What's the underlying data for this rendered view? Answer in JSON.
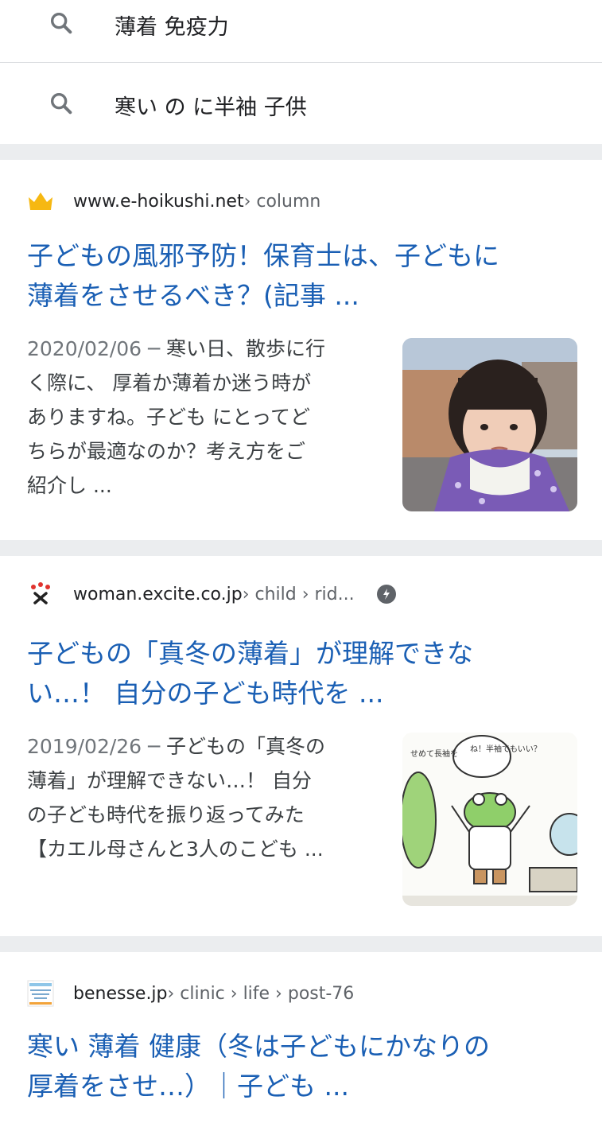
{
  "suggestions": [
    {
      "text": "薄着 免疫力"
    },
    {
      "text": "寒い の に半袖 子供"
    }
  ],
  "results": [
    {
      "domain": "www.e-hoikushi.net",
      "breadcrumb": " › column",
      "title_line1": "子どもの風邪予防！保育士は、子どもに",
      "title_line2": "薄着をさせるべき？(記事 ...",
      "date": "2020/02/06",
      "snippet_lines": [
        "寒い日、散歩に行",
        "く際に、 厚着か薄着か迷う時が",
        "ありますね。子ども にとってど",
        "ちらが最適なのか？考え方をご",
        "紹介し ..."
      ],
      "thumbnail_icon": "child-photo-thumbnail"
    },
    {
      "domain": "woman.excite.co.jp",
      "breadcrumb": " › child › rid...",
      "title_line1": "子どもの「真冬の薄着」が理解できな",
      "title_line2": "い…！ 自分の子ども時代を ...",
      "date": "2019/02/26",
      "snippet_lines": [
        "子どもの「真冬の",
        "薄着」が理解できない…！ 自分",
        "の子ども時代を振り返ってみた",
        "【カエル母さんと3人のこども ..."
      ],
      "thumbnail_icon": "frog-comic-thumbnail",
      "comic_text": "ね！半袖でもいい？",
      "comic_text2": "せめて長袖を"
    },
    {
      "domain": "benesse.jp",
      "breadcrumb": " › clinic › life › post-76",
      "title_line1": "寒い 薄着 健康（冬は子どもにかなりの",
      "title_line2": "厚着をさせ…）｜子ども ..."
    }
  ],
  "colors": {
    "link": "#1a5fb4",
    "gap": "#ebedef",
    "muted": "#5f6368"
  }
}
